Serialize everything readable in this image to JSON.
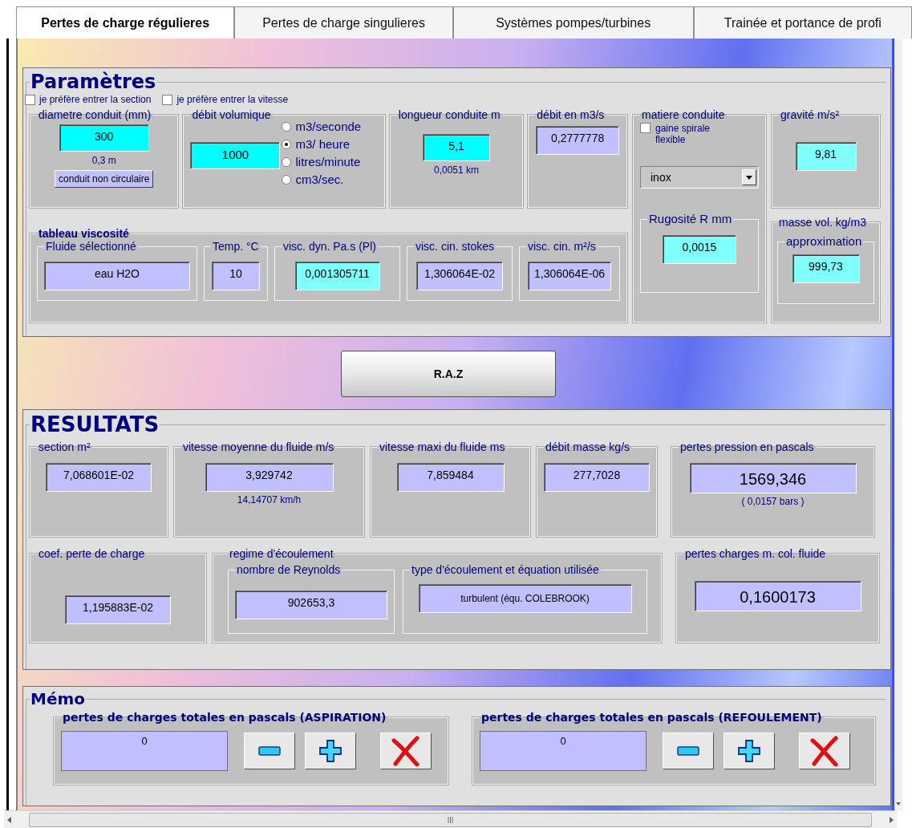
{
  "tabs": [
    {
      "label": "Pertes de charge régulieres",
      "selected": true
    },
    {
      "label": "Pertes de charge singulieres",
      "selected": false
    },
    {
      "label": "Systèmes pompes/turbines",
      "selected": false
    },
    {
      "label": "Trainée et portance de profi",
      "selected": false
    }
  ],
  "parametres": {
    "title": "Paramètres",
    "options": [
      {
        "label": "je préfère entrer la section",
        "checked": false
      },
      {
        "label": "je préfère entrer la vitesse",
        "checked": false
      }
    ],
    "diametre": {
      "label": "diametre  conduit (mm)",
      "value": "300",
      "kind": "input",
      "note": "0,3 m",
      "button": "conduit non circulaire"
    },
    "debit_volumique": {
      "label": "débit volumique",
      "value": "1000",
      "kind": "input",
      "units": [
        {
          "label": "m3/seconde",
          "selected": false
        },
        {
          "label": "m3/ heure",
          "selected": true
        },
        {
          "label": "litres/minute",
          "selected": false
        },
        {
          "label": "cm3/sec.",
          "selected": false
        }
      ]
    },
    "longueur": {
      "label": "longueur conduite m",
      "value": "5,1",
      "kind": "input",
      "note": "0,0051 km"
    },
    "debit_m3s": {
      "label": "débit  en m3/s",
      "value": "0,2777778",
      "kind": "output"
    },
    "matiere": {
      "label": "matiere  conduite",
      "option": {
        "label": "gaine spirale flexible",
        "checked": false
      },
      "select": "inox",
      "rugosite": {
        "label": "Rugosité R mm",
        "value": "0,0015",
        "kind": "light"
      }
    },
    "gravite": {
      "label": "gravité m/s²",
      "value": "9,81",
      "kind": "light"
    },
    "masse_vol": {
      "label": "masse vol. kg/m3",
      "sub_label": "approximation",
      "value": "999,73",
      "kind": "light"
    },
    "viscosite": {
      "title": "tableau viscosité",
      "fields": [
        {
          "label": "Fluide sélectionné",
          "value": "eau H2O",
          "kind": "output"
        },
        {
          "label": "Temp. °C",
          "value": "10",
          "kind": "output"
        },
        {
          "label": "visc. dyn. Pa.s  (Pl)",
          "value": "0,001305711",
          "kind": "light"
        },
        {
          "label": "visc. cin. stokes",
          "value": "1,306064E-02",
          "kind": "output"
        },
        {
          "label": "visc. cin. m²/s",
          "value": "1,306064E-06",
          "kind": "output"
        }
      ]
    }
  },
  "raz_button": "R.A.Z",
  "resultats": {
    "title": "RESULTATS",
    "row1": [
      {
        "label": "section m²",
        "value": "7,068601E-02",
        "kind": "output"
      },
      {
        "label": "vitesse moyenne du fluide m/s",
        "value": "3,929742",
        "kind": "output",
        "note": "14,14707 km/h"
      },
      {
        "label": "vitesse maxi du fluide ms",
        "value": "7,859484",
        "kind": "output"
      },
      {
        "label": "débit masse kg/s",
        "value": "277,7028",
        "kind": "output"
      },
      {
        "label": "pertes pression  en pascals",
        "value": "1569,346",
        "kind": "big",
        "note": "( 0,0157  bars )"
      }
    ],
    "coef": {
      "label": "coef. perte de charge",
      "value": "1,195883E-02",
      "kind": "output"
    },
    "regime": {
      "label": "regime d'écoulement",
      "reynolds": {
        "label": "nombre de Reynolds",
        "value": "902653,3",
        "kind": "output"
      },
      "type": {
        "label": "type d'écoulement et équation utilisée",
        "value": "turbulent (équ. COLEBROOK)",
        "kind": "small"
      }
    },
    "pertes_charges": {
      "label": "pertes charges m. col. fluide",
      "value": "0,1600173",
      "kind": "big"
    }
  },
  "memo": {
    "title": "Mémo",
    "totals": [
      {
        "label": "pertes de charges totales en pascals (ASPIRATION)",
        "value": "0"
      },
      {
        "label": "pertes de charges totales en pascals (REFOULEMENT)",
        "value": "0"
      }
    ]
  }
}
